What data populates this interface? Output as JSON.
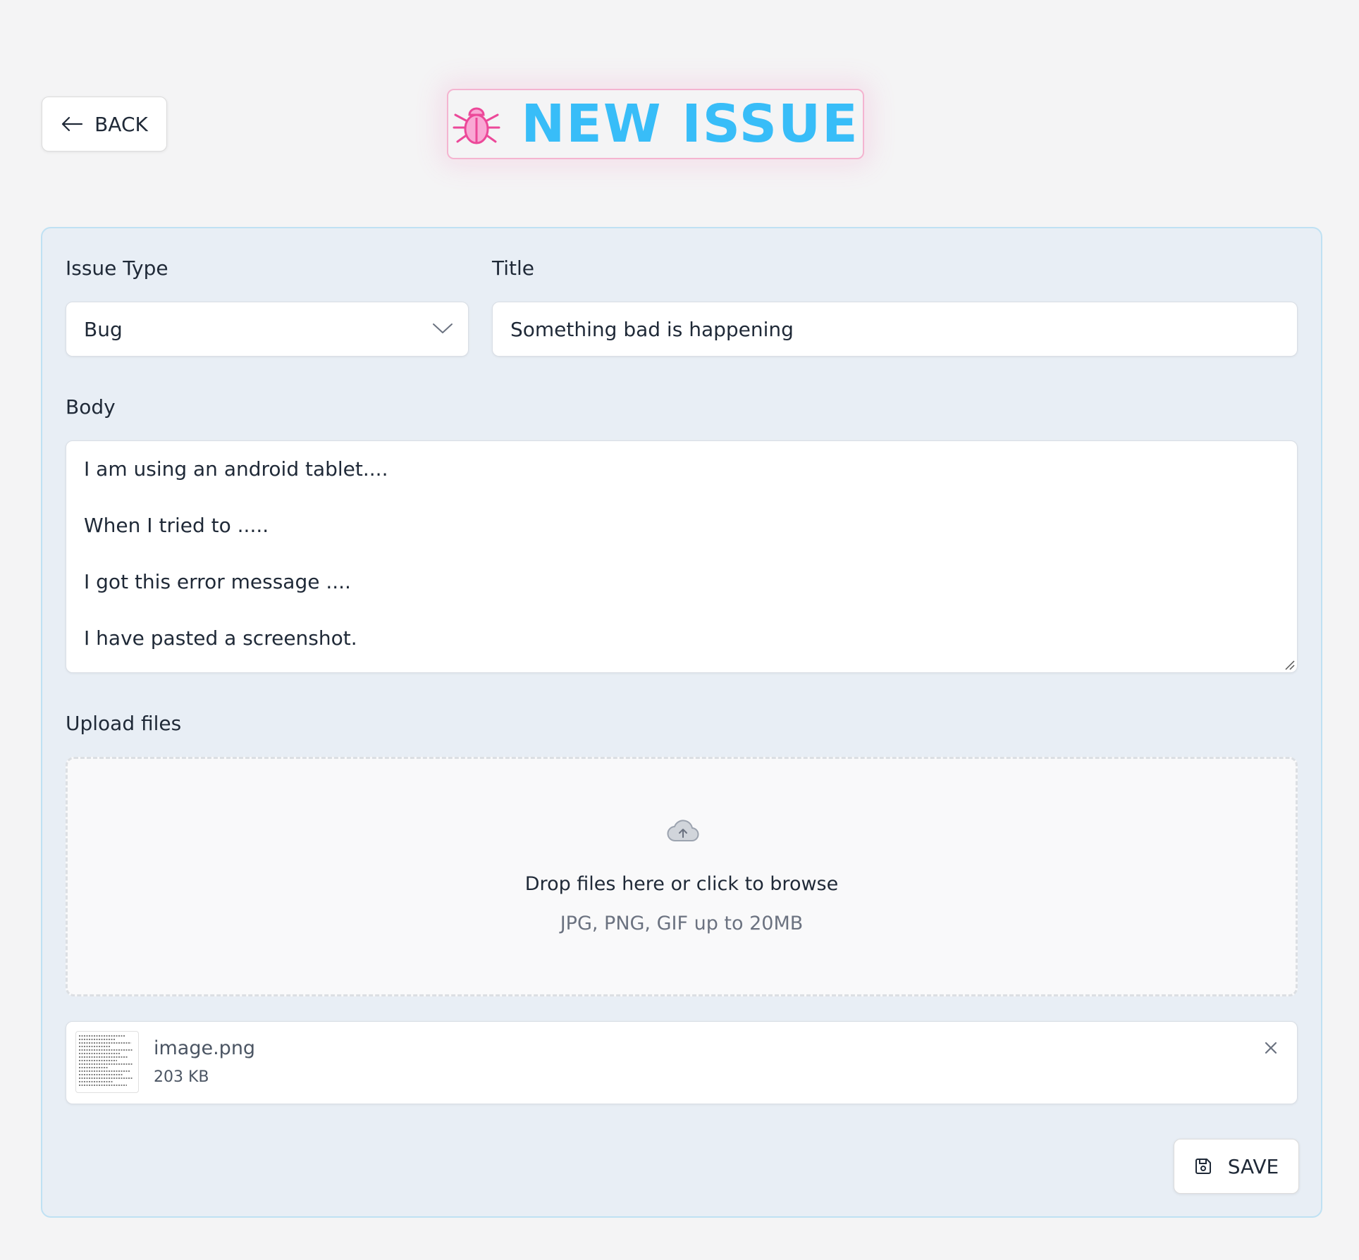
{
  "header": {
    "back_label": "BACK",
    "title": "NEW ISSUE",
    "title_color": "#38bdf8",
    "icon_color": "#ec4899",
    "icons": {
      "back": "arrow-left-icon",
      "title": "bug-icon"
    }
  },
  "form": {
    "issue_type": {
      "label": "Issue Type",
      "value": "Bug"
    },
    "title": {
      "label": "Title",
      "value": "Something bad is happening"
    },
    "body": {
      "label": "Body",
      "lines": [
        "I am using an android tablet....",
        "When I tried to .....",
        "I got this error message ....",
        "I have pasted a screenshot."
      ]
    },
    "upload": {
      "label": "Upload files",
      "dropzone_text": "Drop files here or click to browse",
      "dropzone_hint": "JPG, PNG, GIF up to 20MB",
      "icon": "cloud-upload-icon"
    },
    "files": [
      {
        "name": "image.png",
        "size": "203 KB"
      }
    ],
    "save_label": "SAVE"
  },
  "colors": {
    "panel_bg": "#e8eef5",
    "panel_border": "#bfe1f3",
    "badge_border": "#f4b4d0"
  }
}
